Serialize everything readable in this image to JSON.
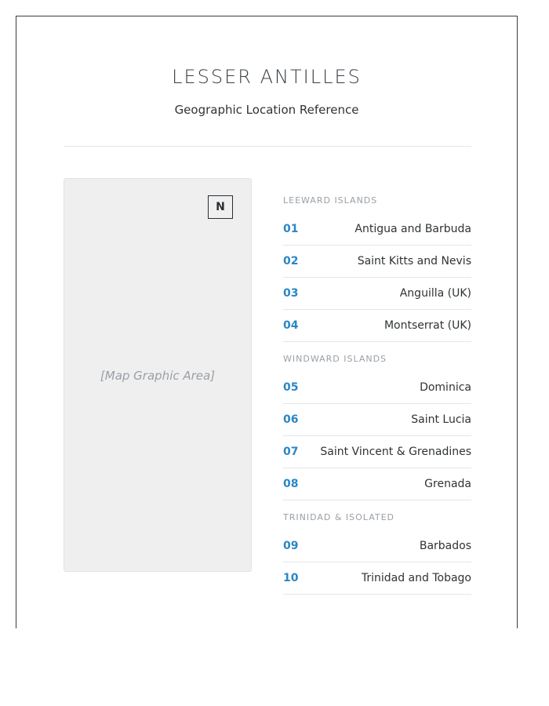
{
  "header": {
    "title": "LESSER ANTILLES",
    "subtitle": "Geographic Location Reference"
  },
  "map": {
    "compass_label": "N",
    "placeholder": "[Map Graphic Area]"
  },
  "sections": [
    {
      "label": "LEEWARD ISLANDS",
      "items": [
        {
          "num": "01",
          "name": "Antigua and Barbuda"
        },
        {
          "num": "02",
          "name": "Saint Kitts and Nevis"
        },
        {
          "num": "03",
          "name": "Anguilla (UK)"
        },
        {
          "num": "04",
          "name": "Montserrat (UK)"
        }
      ]
    },
    {
      "label": "WINDWARD ISLANDS",
      "items": [
        {
          "num": "05",
          "name": "Dominica"
        },
        {
          "num": "06",
          "name": "Saint Lucia"
        },
        {
          "num": "07",
          "name": "Saint Vincent & Grenadines"
        },
        {
          "num": "08",
          "name": "Grenada"
        }
      ]
    },
    {
      "label": "TRINIDAD & ISOLATED",
      "items": [
        {
          "num": "09",
          "name": "Barbados"
        },
        {
          "num": "10",
          "name": "Trinidad and Tobago"
        }
      ]
    }
  ],
  "colors": {
    "accent": "#2a86c4",
    "muted": "#9aa0a6",
    "map_background": "#efefef"
  }
}
